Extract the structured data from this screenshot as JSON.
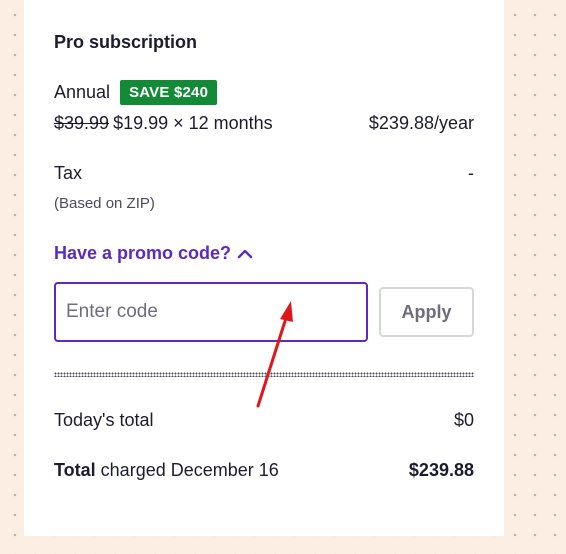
{
  "plan": {
    "title": "Pro subscription",
    "billing_label": "Annual",
    "save_badge": "SAVE $240",
    "old_price": "$39.99",
    "price_detail": "$19.99 × 12 months",
    "yearly_price": "$239.88/year"
  },
  "tax": {
    "label": "Tax",
    "value": "-",
    "note": "(Based on ZIP)"
  },
  "promo": {
    "toggle_label": "Have a promo code?",
    "toggle_icon": "chevron-up-icon",
    "input_placeholder": "Enter code",
    "input_value": "",
    "apply_label": "Apply"
  },
  "totals": {
    "today_label": "Today's total",
    "today_value": "$0",
    "charged_bold": "Total",
    "charged_label": " charged December 16",
    "charged_value": "$239.88"
  },
  "colors": {
    "accent_purple": "#5b2bbd",
    "badge_green": "#138a36",
    "annotation_red": "#e0161b",
    "page_background": "#fdeee4"
  }
}
